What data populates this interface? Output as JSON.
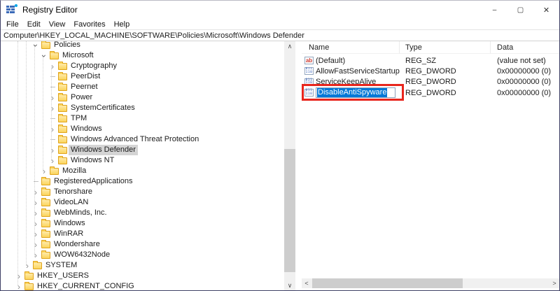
{
  "window": {
    "title": "Registry Editor",
    "controls": {
      "minimize": "–",
      "maximize": "▢",
      "close": "✕"
    }
  },
  "menu": {
    "items": [
      "File",
      "Edit",
      "View",
      "Favorites",
      "Help"
    ]
  },
  "address": {
    "value": "Computer\\HKEY_LOCAL_MACHINE\\SOFTWARE\\Policies\\Microsoft\\Windows Defender"
  },
  "tree": {
    "items": [
      {
        "label": "Policies",
        "level": 3,
        "state": "expanded",
        "selected": false
      },
      {
        "label": "Microsoft",
        "level": 4,
        "state": "expanded",
        "selected": false
      },
      {
        "label": "Cryptography",
        "level": 5,
        "state": "collapsed",
        "selected": false
      },
      {
        "label": "PeerDist",
        "level": 5,
        "state": "leaf",
        "selected": false
      },
      {
        "label": "Peernet",
        "level": 5,
        "state": "leaf",
        "selected": false
      },
      {
        "label": "Power",
        "level": 5,
        "state": "collapsed",
        "selected": false
      },
      {
        "label": "SystemCertificates",
        "level": 5,
        "state": "collapsed",
        "selected": false
      },
      {
        "label": "TPM",
        "level": 5,
        "state": "leaf",
        "selected": false
      },
      {
        "label": "Windows",
        "level": 5,
        "state": "collapsed",
        "selected": false
      },
      {
        "label": "Windows Advanced Threat Protection",
        "level": 5,
        "state": "leaf",
        "selected": false
      },
      {
        "label": "Windows Defender",
        "level": 5,
        "state": "collapsed",
        "selected": true
      },
      {
        "label": "Windows NT",
        "level": 5,
        "state": "collapsed",
        "selected": false
      },
      {
        "label": "Mozilla",
        "level": 4,
        "state": "collapsed",
        "selected": false
      },
      {
        "label": "RegisteredApplications",
        "level": 3,
        "state": "leaf",
        "selected": false
      },
      {
        "label": "Tenorshare",
        "level": 3,
        "state": "collapsed",
        "selected": false
      },
      {
        "label": "VideoLAN",
        "level": 3,
        "state": "collapsed",
        "selected": false
      },
      {
        "label": "WebMinds, Inc.",
        "level": 3,
        "state": "collapsed",
        "selected": false
      },
      {
        "label": "Windows",
        "level": 3,
        "state": "collapsed",
        "selected": false
      },
      {
        "label": "WinRAR",
        "level": 3,
        "state": "collapsed",
        "selected": false
      },
      {
        "label": "Wondershare",
        "level": 3,
        "state": "collapsed",
        "selected": false
      },
      {
        "label": "WOW6432Node",
        "level": 3,
        "state": "collapsed",
        "selected": false
      },
      {
        "label": "SYSTEM",
        "level": 2,
        "state": "collapsed",
        "selected": false
      },
      {
        "label": "HKEY_USERS",
        "level": 1,
        "state": "collapsed",
        "selected": false
      },
      {
        "label": "HKEY_CURRENT_CONFIG",
        "level": 1,
        "state": "collapsed",
        "selected": false
      }
    ]
  },
  "list": {
    "columns": [
      "Name",
      "Type",
      "Data"
    ],
    "rows": [
      {
        "name": "(Default)",
        "type": "REG_SZ",
        "data": "(value not set)",
        "icon": "string-value-icon",
        "editing": false
      },
      {
        "name": "AllowFastServiceStartup",
        "type": "REG_DWORD",
        "data": "0x00000000 (0)",
        "icon": "dword-value-icon",
        "editing": false
      },
      {
        "name": "ServiceKeepAlive",
        "type": "REG_DWORD",
        "data": "0x00000000 (0)",
        "icon": "dword-value-icon",
        "editing": false
      },
      {
        "name": "DisableAntiSpyware",
        "type": "REG_DWORD",
        "data": "0x00000000 (0)",
        "icon": "dword-value-icon",
        "editing": true
      }
    ]
  },
  "icons": {
    "string_glyph": "ab",
    "dword_glyph_top": "011",
    "dword_glyph_bottom": "110",
    "scroll_up": "∧",
    "scroll_down": "∨",
    "scroll_left": "<",
    "scroll_right": ">",
    "expander_glyph": "›"
  },
  "colors": {
    "selection_blue": "#0078d7",
    "annotation_red": "#e8261d",
    "tree_selection_gray": "#d4d4d4",
    "folder_yellow": "#fbd45c",
    "scrollbar_track": "#f0f0f0",
    "scrollbar_thumb": "#cdcdcd"
  }
}
